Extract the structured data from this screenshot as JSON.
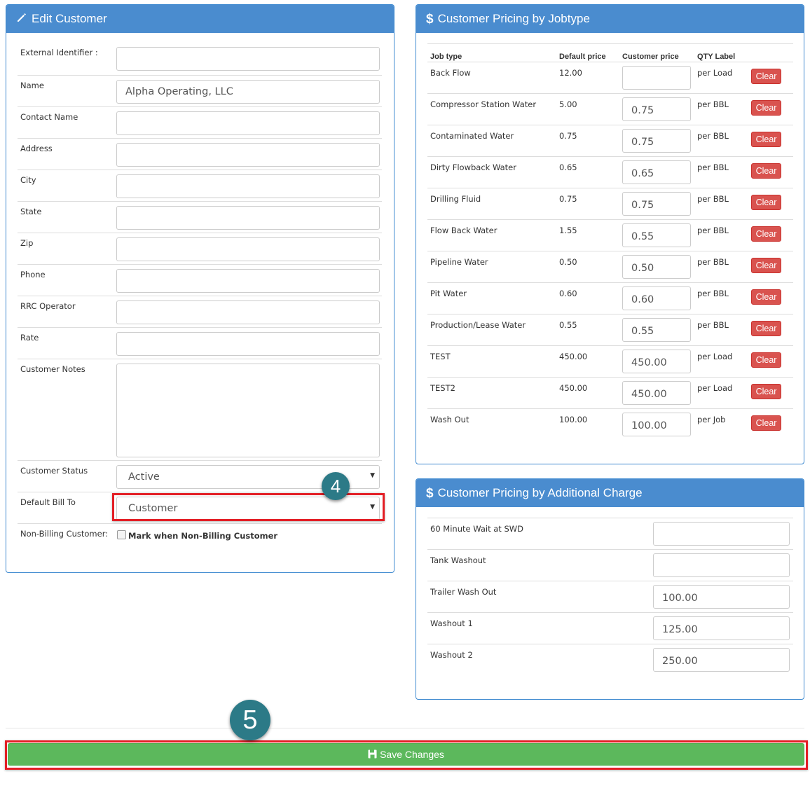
{
  "edit_customer": {
    "title": "Edit Customer",
    "fields": [
      {
        "label": "External Identifier :",
        "value": ""
      },
      {
        "label": "Name",
        "value": "Alpha Operating, LLC"
      },
      {
        "label": "Contact Name",
        "value": ""
      },
      {
        "label": "Address",
        "value": ""
      },
      {
        "label": "City",
        "value": ""
      },
      {
        "label": "State",
        "value": ""
      },
      {
        "label": "Zip",
        "value": ""
      },
      {
        "label": "Phone",
        "value": ""
      },
      {
        "label": "RRC Operator",
        "value": ""
      },
      {
        "label": "Rate",
        "value": ""
      }
    ],
    "notes": {
      "label": "Customer Notes",
      "value": ""
    },
    "status": {
      "label": "Customer Status",
      "value": "Active"
    },
    "bill_to": {
      "label": "Default Bill To",
      "value": "Customer"
    },
    "non_billing": {
      "label": "Non-Billing Customer:",
      "checkbox_label": "Mark when Non-Billing Customer"
    }
  },
  "jobtype_pricing": {
    "title": "Customer Pricing by Jobtype",
    "headers": {
      "job_type": "Job type",
      "default_price": "Default price",
      "customer_price": "Customer price",
      "qty_label": "QTY Label"
    },
    "clear_label": "Clear",
    "rows": [
      {
        "job_type": "Back Flow",
        "default_price": "12.00",
        "customer_price": "",
        "qty": "per Load"
      },
      {
        "job_type": "Compressor Station Water",
        "default_price": "5.00",
        "customer_price": "0.75",
        "qty": "per BBL"
      },
      {
        "job_type": "Contaminated Water",
        "default_price": "0.75",
        "customer_price": "0.75",
        "qty": "per BBL"
      },
      {
        "job_type": "Dirty Flowback Water",
        "default_price": "0.65",
        "customer_price": "0.65",
        "qty": "per BBL"
      },
      {
        "job_type": "Drilling Fluid",
        "default_price": "0.75",
        "customer_price": "0.75",
        "qty": "per BBL"
      },
      {
        "job_type": "Flow Back Water",
        "default_price": "1.55",
        "customer_price": "0.55",
        "qty": "per BBL"
      },
      {
        "job_type": "Pipeline Water",
        "default_price": "0.50",
        "customer_price": "0.50",
        "qty": "per BBL"
      },
      {
        "job_type": "Pit Water",
        "default_price": "0.60",
        "customer_price": "0.60",
        "qty": "per BBL"
      },
      {
        "job_type": "Production/Lease Water",
        "default_price": "0.55",
        "customer_price": "0.55",
        "qty": "per BBL"
      },
      {
        "job_type": "TEST",
        "default_price": "450.00",
        "customer_price": "450.00",
        "qty": "per Load"
      },
      {
        "job_type": "TEST2",
        "default_price": "450.00",
        "customer_price": "450.00",
        "qty": "per Load"
      },
      {
        "job_type": "Wash Out",
        "default_price": "100.00",
        "customer_price": "100.00",
        "qty": "per Job"
      }
    ]
  },
  "additional_charge_pricing": {
    "title": "Customer Pricing by Additional Charge",
    "rows": [
      {
        "name": "60 Minute Wait at SWD",
        "value": ""
      },
      {
        "name": "Tank Washout",
        "value": ""
      },
      {
        "name": "Trailer Wash Out",
        "value": "100.00"
      },
      {
        "name": "Washout 1",
        "value": "125.00"
      },
      {
        "name": "Washout 2",
        "value": "250.00"
      }
    ]
  },
  "save_button": {
    "label": "Save Changes"
  },
  "callouts": {
    "step4": "4",
    "step5": "5"
  },
  "colors": {
    "panel_header": "#4a8ccf",
    "clear_button": "#d9534f",
    "save_button": "#5cb85c",
    "highlight": "#e31e25",
    "callout": "#2c7a87"
  }
}
